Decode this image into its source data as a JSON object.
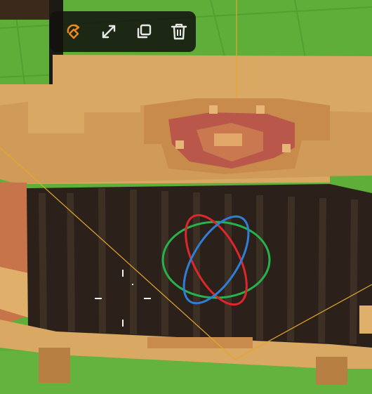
{
  "colors": {
    "grass": "#5fae3a",
    "grass_grid": "#4e9a2f",
    "wood_light": "#d9a862",
    "wood_dark": "#b77f42",
    "red_accent": "#b9574b",
    "panel_dark": "#2b211a",
    "toolbar_bg": "#11120e",
    "tool_active": "#f08a1c",
    "tool_default": "#e8e8e8",
    "gizmo_x": "#e0262a",
    "gizmo_y": "#25b34b",
    "gizmo_z": "#2f7fd8",
    "bounds_line": "#e6a62a"
  },
  "toolbar": {
    "tools": [
      {
        "name": "rotate",
        "icon": "rotate-icon",
        "active": true
      },
      {
        "name": "scale",
        "icon": "scale-icon",
        "active": false
      },
      {
        "name": "duplicate",
        "icon": "duplicate-icon",
        "active": false
      },
      {
        "name": "delete",
        "icon": "trash-icon",
        "active": false
      }
    ]
  }
}
